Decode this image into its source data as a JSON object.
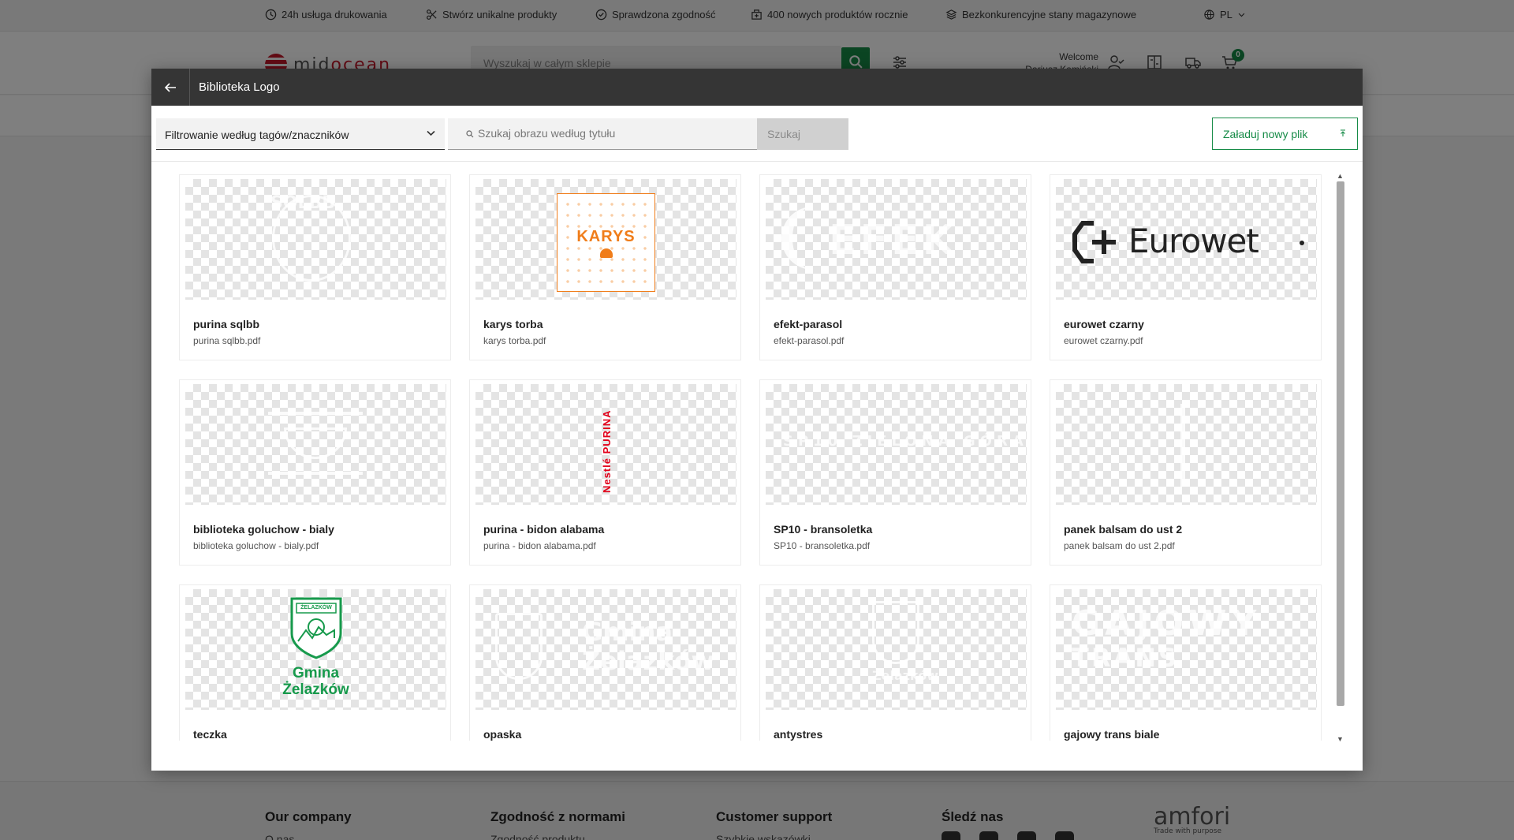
{
  "topbar": {
    "items": [
      {
        "icon": "clock-icon",
        "label": "24h usługa drukowania"
      },
      {
        "icon": "scissors-icon",
        "label": "Stwórz unikalne produkty"
      },
      {
        "icon": "check-circle-icon",
        "label": "Sprawdzona zgodność"
      },
      {
        "icon": "box-plus-icon",
        "label": "400 nowych produktów rocznie"
      },
      {
        "icon": "layers-icon",
        "label": "Bezkonkurencyjne stany magazynowe"
      }
    ],
    "language": "PL"
  },
  "header": {
    "logo_brand": "mid",
    "logo_accent": "ocean",
    "search_placeholder": "Wyszukaj w całym sklepie",
    "welcome_label": "Welcome",
    "welcome_name": "Dariusz Kamiński",
    "cart_count": "0"
  },
  "modal": {
    "title": "Biblioteka Logo",
    "filter_label": "Filtrowanie według tagów/znaczników",
    "search_placeholder": "Szukaj obrazu według tytułu",
    "search_button": "Szukaj",
    "upload_button": "Załaduj nowy plik",
    "items": [
      {
        "title": "purina sqlbb",
        "file": "purina sqlbb.pdf"
      },
      {
        "title": "karys torba",
        "file": "karys torba.pdf"
      },
      {
        "title": "efekt-parasol",
        "file": "efekt-parasol.pdf"
      },
      {
        "title": "eurowet czarny",
        "file": "eurowet czarny.pdf"
      },
      {
        "title": "biblioteka goluchow - bialy",
        "file": "biblioteka goluchow - bialy.pdf"
      },
      {
        "title": "purina - bidon alabama",
        "file": "purina - bidon alabama.pdf"
      },
      {
        "title": "SP10 - bransoletka",
        "file": "SP10 - bransoletka.pdf"
      },
      {
        "title": "panek balsam do ust 2",
        "file": "panek balsam do ust 2.pdf"
      },
      {
        "title": "teczka",
        "file": ""
      },
      {
        "title": "opaska",
        "file": ""
      },
      {
        "title": "antystres",
        "file": ""
      },
      {
        "title": "gajowy trans biale",
        "file": ""
      }
    ],
    "logos": {
      "karys": "KARYS",
      "eurowet": "Eurowet",
      "nestle_purina": "Nestlé PURINA",
      "gmina_line1": "Gmina",
      "gmina_line2": "Żelazków",
      "zelazkow_crest": "ŻELAZKÓW"
    }
  },
  "footer": {
    "columns": [
      {
        "title": "Our company",
        "first_link": "O nas"
      },
      {
        "title": "Zgodność z normami",
        "first_link": "Zgodność produktu"
      },
      {
        "title": "Customer support",
        "first_link": "Szybkie wskazówki"
      },
      {
        "title": "Śledź nas",
        "first_link": ""
      }
    ],
    "amfori": "amfori",
    "amfori_tagline": "Trade with purpose"
  },
  "colors": {
    "accent": "#168b47",
    "modal_header": "#353535",
    "brand_red": "#c5182b",
    "karys_orange": "#f07d1a",
    "purina_red": "#e2001a"
  }
}
